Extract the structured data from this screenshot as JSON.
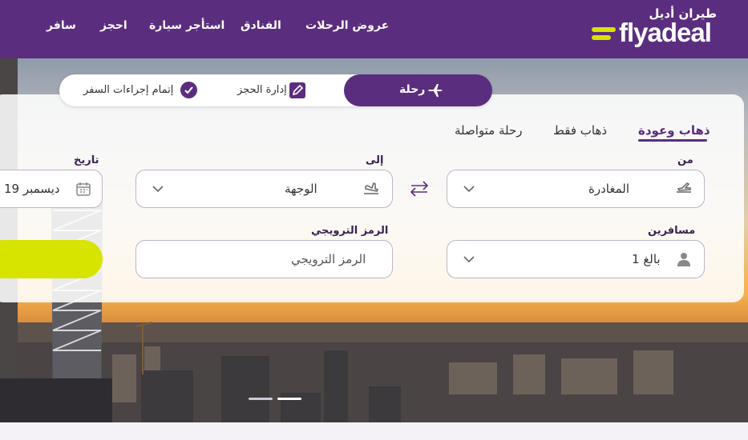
{
  "header": {
    "logo_ar": "طيران أديل",
    "logo_en": "flyadeal",
    "nav": [
      "عروض الرحلات",
      "الفنادق",
      "استأجر سيارة",
      "احجز",
      "سافر"
    ]
  },
  "tabs": {
    "flight": "رحلة",
    "manage": "إدارة الحجز",
    "checkin": "إتمام إجراءات السفر"
  },
  "trip_types": {
    "round_trip": "ذهاب وعودة",
    "one_way": "ذهاب فقط",
    "multi_city": "رحلة متواصلة",
    "selected": "round_trip"
  },
  "form": {
    "from_label": "من",
    "from_value": "المغادرة",
    "to_label": "إلى",
    "to_value": "الوجهة",
    "date_label": "تاريخ",
    "date_value": "19 ديسمبر",
    "passengers_label": "مسافرين",
    "passengers_value": "1 بالغ",
    "promo_label": "الرمز الترويجي",
    "promo_placeholder": "الرمز الترويجي"
  },
  "carousel": {
    "slides": 2,
    "active_index": 1
  },
  "colors": {
    "brand": "#5b2d7e",
    "accent": "#d7e400"
  }
}
